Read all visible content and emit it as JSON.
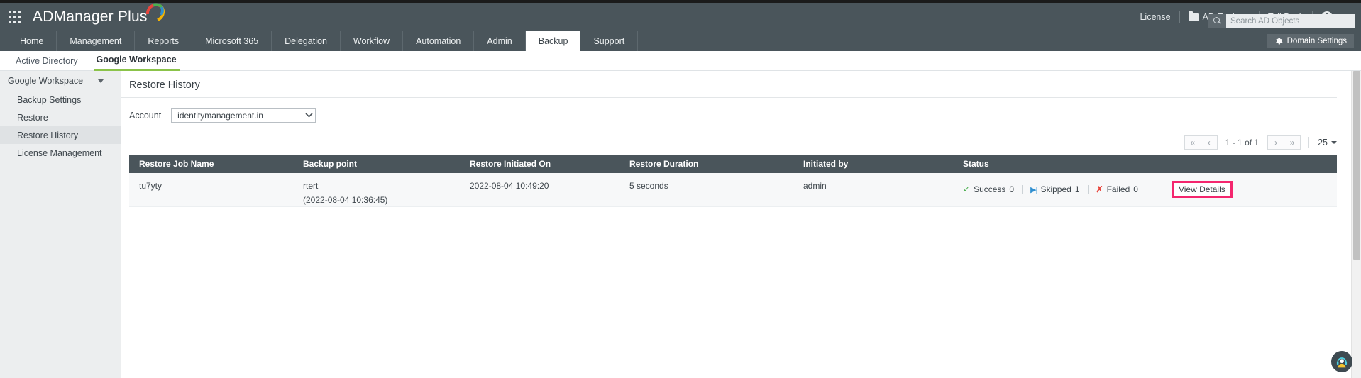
{
  "header": {
    "brand": "ADManager",
    "brand_plus": " Plus",
    "waffle_label": "apps-grid-icon",
    "right_items": [
      {
        "label": "License",
        "icon": null
      },
      {
        "label": "AD Explorer",
        "icon": "folder-icon"
      },
      {
        "label": "TalkBack",
        "icon": null
      }
    ],
    "search": {
      "placeholder": "Search AD Objects",
      "value": ""
    }
  },
  "nav": {
    "tabs": [
      {
        "label": "Home",
        "active": false
      },
      {
        "label": "Management",
        "active": false
      },
      {
        "label": "Reports",
        "active": false
      },
      {
        "label": "Microsoft 365",
        "active": false
      },
      {
        "label": "Delegation",
        "active": false
      },
      {
        "label": "Workflow",
        "active": false
      },
      {
        "label": "Automation",
        "active": false
      },
      {
        "label": "Admin",
        "active": false
      },
      {
        "label": "Backup",
        "active": true
      },
      {
        "label": "Support",
        "active": false
      }
    ],
    "domain_settings": "Domain Settings"
  },
  "subnav": {
    "tabs": [
      {
        "label": "Active Directory",
        "active": false
      },
      {
        "label": "Google Workspace",
        "active": true
      }
    ]
  },
  "sidebar": {
    "heading": "Google Workspace",
    "items": [
      {
        "label": "Backup Settings",
        "active": false
      },
      {
        "label": "Restore",
        "active": false
      },
      {
        "label": "Restore History",
        "active": true
      },
      {
        "label": "License Management",
        "active": false
      }
    ]
  },
  "main": {
    "page_title": "Restore History",
    "account_label": "Account",
    "account_value": "identitymanagement.in",
    "pagination": {
      "first": "«",
      "prev": "‹",
      "range": "1 - 1 of 1",
      "next": "›",
      "last": "»",
      "page_size": "25"
    },
    "table": {
      "columns": [
        "Restore Job Name",
        "Backup point",
        "Restore Initiated On",
        "Restore Duration",
        "Initiated by",
        "Status"
      ],
      "rows": [
        {
          "job_name": "tu7yty",
          "backup_point_name": "rtert",
          "backup_point_time": "(2022-08-04 10:36:45)",
          "initiated_on": "2022-08-04 10:49:20",
          "duration": "5 seconds",
          "initiated_by": "admin",
          "status": {
            "success_label": "Success",
            "success_count": "0",
            "skipped_label": "Skipped",
            "skipped_count": "1",
            "failed_label": "Failed",
            "failed_count": "0"
          },
          "action_label": "View Details"
        }
      ]
    }
  },
  "colors": {
    "header_bg": "#4a555b",
    "accent_green": "#8bc34a",
    "highlight_pink": "#f4266e",
    "success_green": "#4caf50",
    "skipped_blue": "#2f8fd0",
    "failed_red": "#e8453c"
  },
  "chat": {
    "icon": "support-agent-avatar-icon"
  }
}
